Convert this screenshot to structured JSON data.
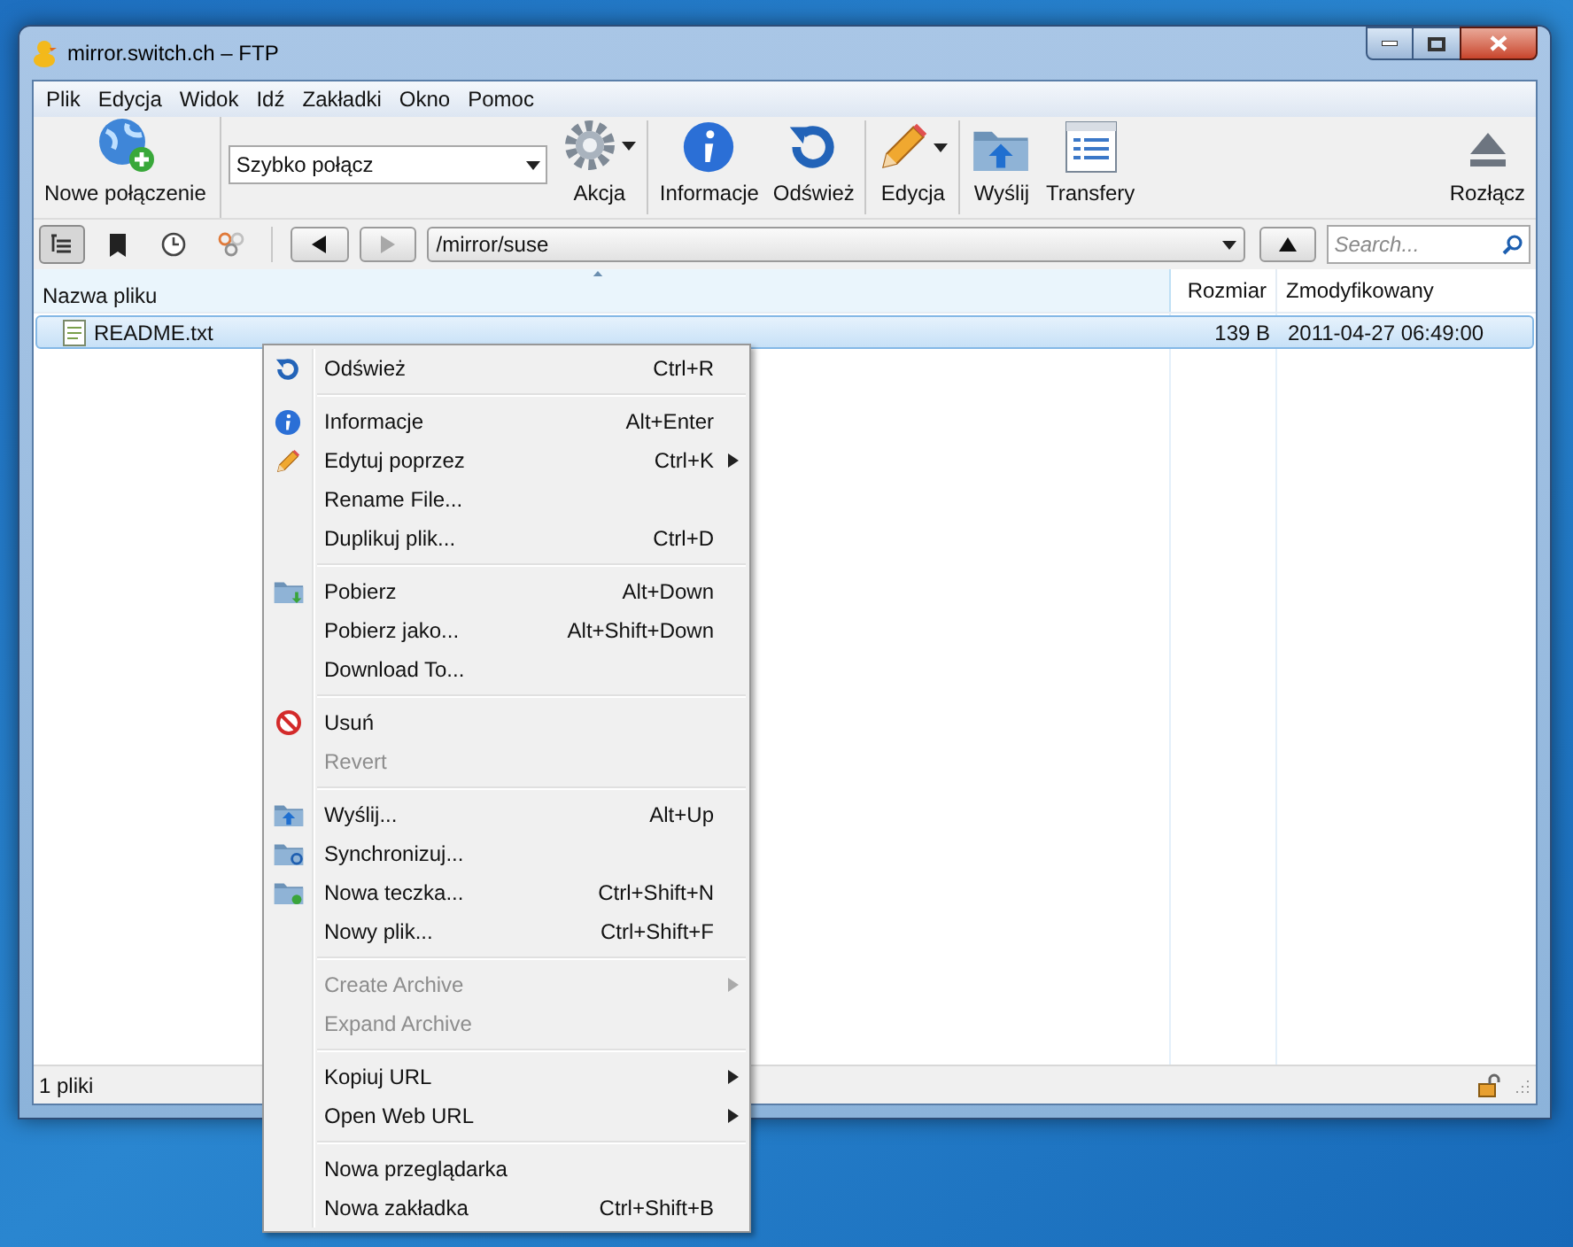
{
  "window": {
    "title": "mirror.switch.ch – FTP"
  },
  "menu_bar": [
    "Plik",
    "Edycja",
    "Widok",
    "Idź",
    "Zakładki",
    "Okno",
    "Pomoc"
  ],
  "toolbar": {
    "items": [
      {
        "kind": "new-connection",
        "label": "Nowe połączenie",
        "dropdown": false
      },
      {
        "kind": "quick-connect",
        "value": "Szybko połącz"
      },
      {
        "kind": "action",
        "label": "Akcja",
        "dropdown": true
      },
      {
        "kind": "info",
        "label": "Informacje",
        "dropdown": false
      },
      {
        "kind": "refresh",
        "label": "Odśwież",
        "dropdown": false
      },
      {
        "kind": "edit",
        "label": "Edycja",
        "dropdown": true
      },
      {
        "kind": "upload",
        "label": "Wyślij",
        "dropdown": false
      },
      {
        "kind": "transfers",
        "label": "Transfery",
        "dropdown": false
      },
      {
        "kind": "disconnect",
        "label": "Rozłącz",
        "dropdown": false
      }
    ]
  },
  "view_toggles": [
    {
      "kind": "browser",
      "selected": true
    },
    {
      "kind": "bookmarks",
      "selected": false
    },
    {
      "kind": "history",
      "selected": false
    },
    {
      "kind": "bonjour",
      "selected": false
    }
  ],
  "navigation": {
    "back_disabled": false,
    "forward_disabled": true,
    "path": "/mirror/suse",
    "search": {
      "placeholder": "Search..."
    }
  },
  "table": {
    "columns": [
      "Nazwa pliku",
      "Rozmiar",
      "Zmodyfikowany"
    ],
    "rows": [
      {
        "name": "README.txt",
        "size": "139 B",
        "modified": "2011-04-27 06:49:00",
        "selected": true
      }
    ]
  },
  "status_bar": {
    "text": "1 pliki",
    "locked": false
  },
  "context_menu": {
    "groups": [
      {
        "items": [
          {
            "kind": "refresh",
            "label": "Odśwież",
            "shortcut": "Ctrl+R",
            "disabled": false,
            "submenu": false
          }
        ]
      },
      {
        "items": [
          {
            "kind": "info",
            "label": "Informacje",
            "shortcut": "Alt+Enter",
            "disabled": false,
            "submenu": false
          },
          {
            "kind": "edit",
            "label": "Edytuj poprzez",
            "shortcut": "Ctrl+K",
            "disabled": false,
            "submenu": true
          },
          {
            "kind": "plain",
            "label": "Rename File...",
            "disabled": false,
            "submenu": false
          },
          {
            "kind": "plain",
            "label": "Duplikuj plik...",
            "shortcut": "Ctrl+D",
            "disabled": false,
            "submenu": false
          }
        ]
      },
      {
        "items": [
          {
            "kind": "download",
            "label": "Pobierz",
            "shortcut": "Alt+Down",
            "disabled": false,
            "submenu": false
          },
          {
            "kind": "plain",
            "label": "Pobierz jako...",
            "shortcut": "Alt+Shift+Down",
            "disabled": false,
            "submenu": false
          },
          {
            "kind": "plain",
            "label": "Download To...",
            "disabled": false,
            "submenu": false
          }
        ]
      },
      {
        "items": [
          {
            "kind": "delete",
            "label": "Usuń",
            "disabled": false,
            "submenu": false
          },
          {
            "kind": "plain",
            "label": "Revert",
            "disabled": true,
            "submenu": false
          }
        ]
      },
      {
        "items": [
          {
            "kind": "upload",
            "label": "Wyślij...",
            "shortcut": "Alt+Up",
            "disabled": false,
            "submenu": false
          },
          {
            "kind": "sync",
            "label": "Synchronizuj...",
            "disabled": false,
            "submenu": false
          },
          {
            "kind": "new-folder",
            "label": "Nowa teczka...",
            "shortcut": "Ctrl+Shift+N",
            "disabled": false,
            "submenu": false
          },
          {
            "kind": "plain",
            "label": "Nowy plik...",
            "shortcut": "Ctrl+Shift+F",
            "disabled": false,
            "submenu": false
          }
        ]
      },
      {
        "items": [
          {
            "kind": "plain",
            "label": "Create Archive",
            "disabled": true,
            "submenu": true
          },
          {
            "kind": "plain",
            "label": "Expand Archive",
            "disabled": true,
            "submenu": false
          }
        ]
      },
      {
        "items": [
          {
            "kind": "plain",
            "label": "Kopiuj URL",
            "disabled": false,
            "submenu": true
          },
          {
            "kind": "plain",
            "label": "Open Web URL",
            "disabled": false,
            "submenu": true
          }
        ]
      },
      {
        "items": [
          {
            "kind": "plain",
            "label": "Nowa przeglądarka",
            "disabled": false,
            "submenu": false
          },
          {
            "kind": "plain",
            "label": "Nowa zakładka",
            "shortcut": "Ctrl+Shift+B",
            "disabled": false,
            "submenu": false
          }
        ]
      }
    ]
  }
}
